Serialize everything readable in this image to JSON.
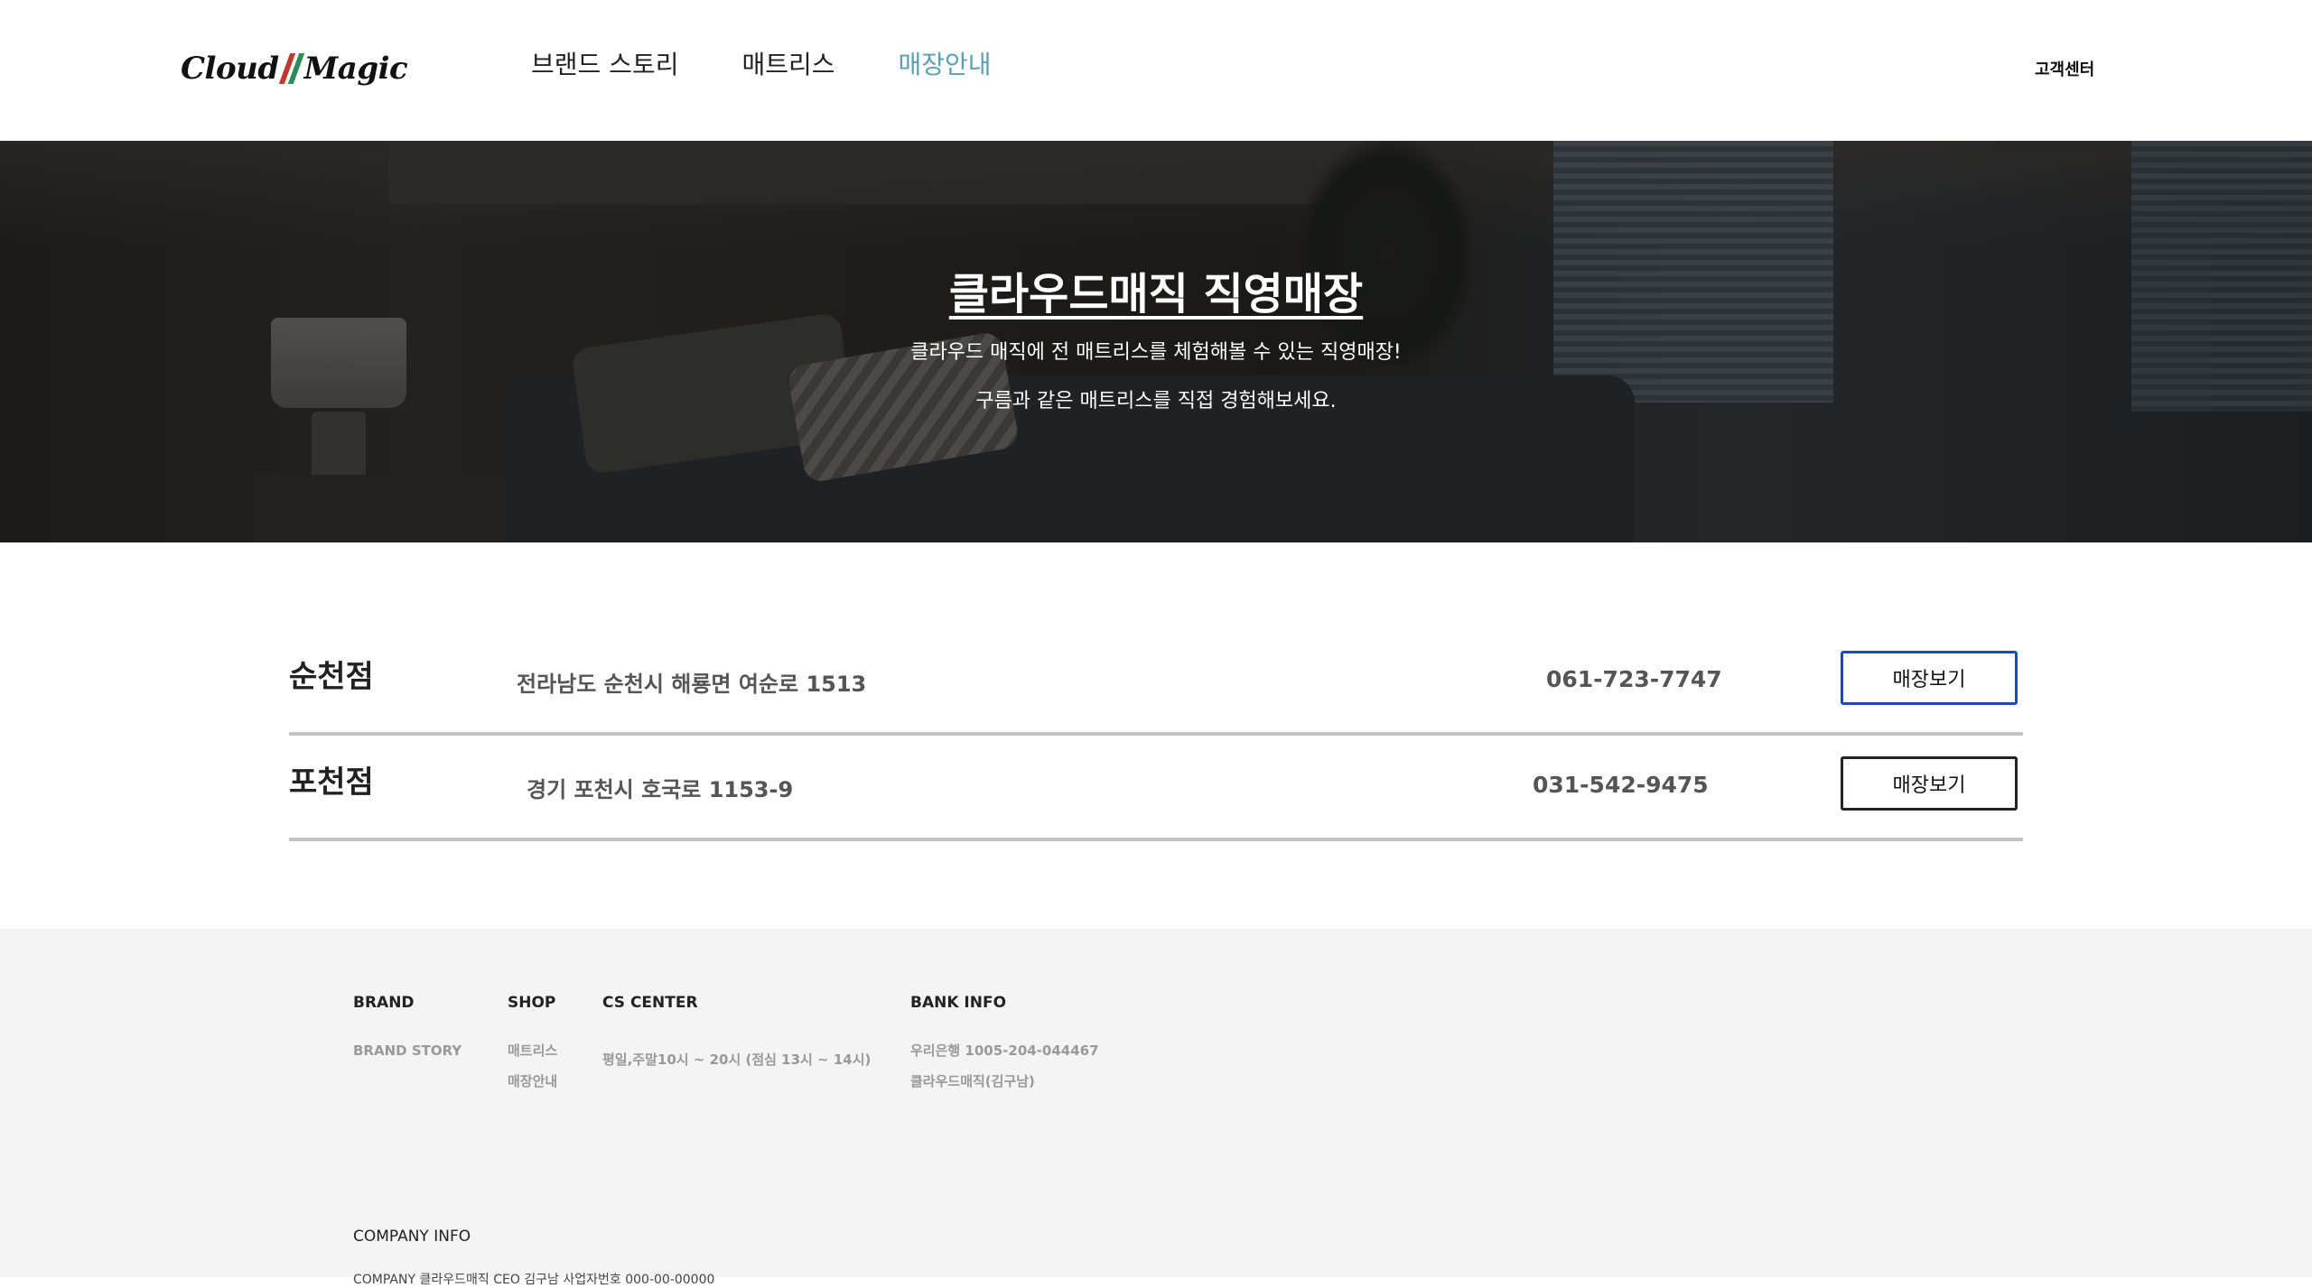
{
  "header": {
    "logo": {
      "word1": "Cloud",
      "word2": "Magic",
      "slash_colors": [
        "#c0392b",
        "#2e8b57"
      ]
    },
    "nav": [
      {
        "label": "브랜드 스토리",
        "active": false
      },
      {
        "label": "매트리스",
        "active": false
      },
      {
        "label": "매장안내",
        "active": true
      }
    ],
    "cs_link": "고객센터"
  },
  "hero": {
    "title": "클라우드매직 직영매장",
    "line1": "클라우드 매직에 전 매트리스를 체험해볼 수 있는 직영매장!",
    "line2": "구름과 같은 매트리스를 직접 경험해보세요."
  },
  "stores": [
    {
      "name": "순천점",
      "address": "전라남도 순천시 해룡면 여순로 1513",
      "phone": "061-723-7747",
      "button": "매장보기"
    },
    {
      "name": "포천점",
      "address": "경기 포천시 호국로 1153-9",
      "phone": "031-542-9475",
      "button": "매장보기"
    }
  ],
  "footer": {
    "brand": {
      "title": "BRAND",
      "items": [
        "BRAND STORY"
      ]
    },
    "shop": {
      "title": "SHOP",
      "items": [
        "매트리스",
        "매장안내"
      ]
    },
    "cs": {
      "title": "CS CENTER",
      "items": [
        "평일,주말10시 ~ 20시 (점심 13시 ~ 14시)"
      ]
    },
    "bank": {
      "title": "BANK INFO",
      "items": [
        "우리은행 1005-204-044467",
        "클라우드매직(김구남)"
      ]
    },
    "company_info": "COMPANY INFO",
    "company_detail": "COMPANY 클라우드매직 CEO 김구남 사업자번호 000-00-00000"
  },
  "colors": {
    "accent": "#5aa0b5",
    "focus_border": "#1e4fa8",
    "footer_bg": "#f4f4f4"
  }
}
